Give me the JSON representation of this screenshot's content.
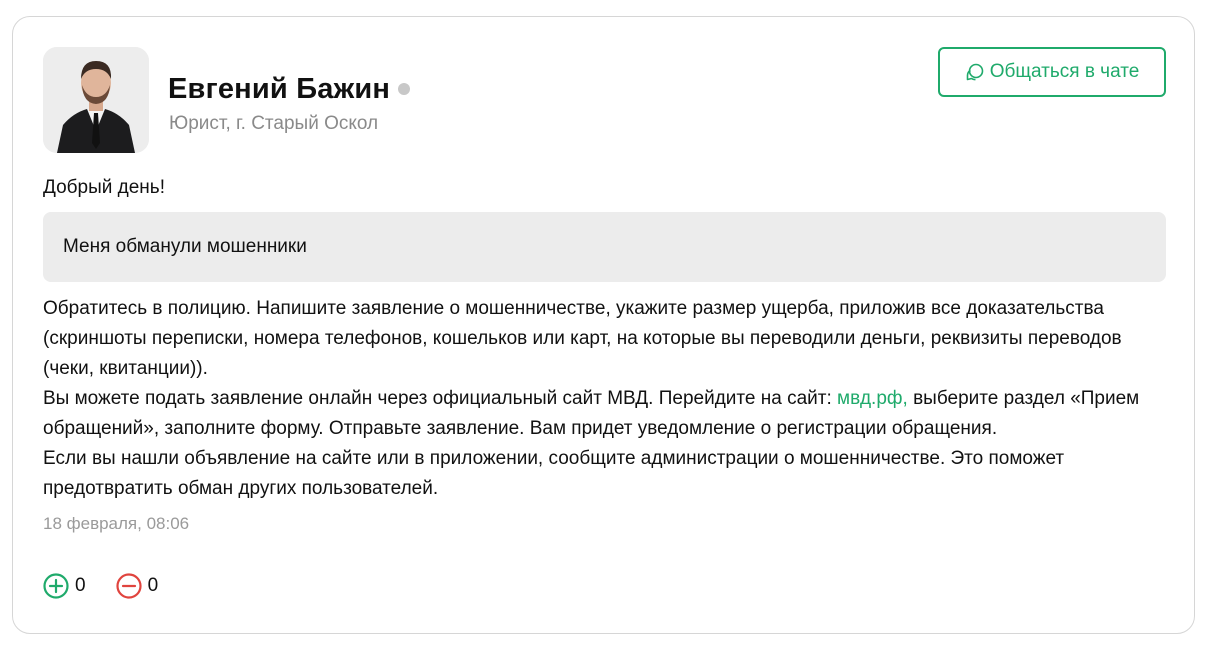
{
  "author": {
    "name": "Евгений Бажин",
    "subtitle": "Юрист, г. Старый Оскол",
    "online": false
  },
  "chat_button": {
    "label": "Общаться в чате",
    "icon": "chat-bubble-icon"
  },
  "message": {
    "greeting": "Добрый день!",
    "question": "Меня обманули мошенники",
    "paragraph1": "Обратитесь в полицию. Напишите заявление о мошенничестве, укажите размер ущерба, приложив все доказательства (скриншоты переписки, номера телефонов, кошельков или карт, на которые вы переводили деньги, реквизиты переводов (чеки, квитанции)).",
    "paragraph2_before": "Вы можете подать заявление онлайн через официальный сайт МВД. Перейдите на сайт: ",
    "link_text": "мвд.рф,",
    "paragraph2_after": " выберите раздел «Прием обращений», заполните форму. Отправьте заявление. Вам придет уведомление о регистрации обращения.",
    "paragraph3": "Если вы нашли объявление на сайте или в приложении, сообщите администрации о мошенничестве. Это поможет предотвратить обман других пользователей.",
    "timestamp": "18 февраля, 08:06"
  },
  "votes": {
    "up": "0",
    "down": "0",
    "up_icon": "plus-circle-icon",
    "down_icon": "minus-circle-icon"
  },
  "colors": {
    "accent": "#1faa6b",
    "negative": "#e0443e",
    "muted": "#8a8a8a",
    "question_bg": "#ececec"
  }
}
